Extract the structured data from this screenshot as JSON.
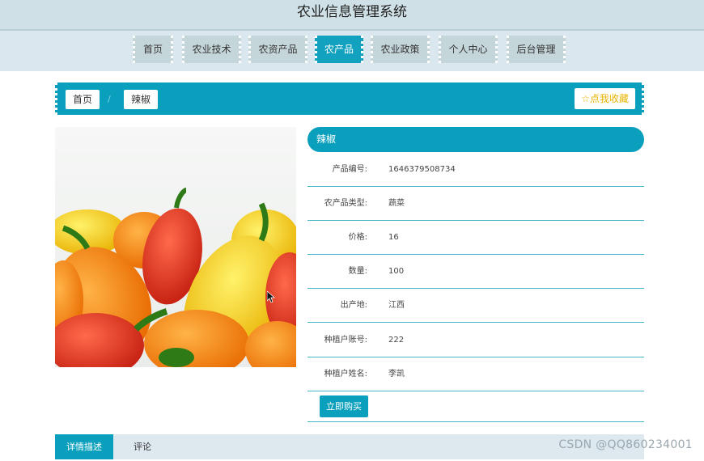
{
  "app": {
    "title": "农业信息管理系统"
  },
  "nav": {
    "items": [
      {
        "label": "首页"
      },
      {
        "label": "农业技术"
      },
      {
        "label": "农资产品"
      },
      {
        "label": "农产品"
      },
      {
        "label": "农业政策"
      },
      {
        "label": "个人中心"
      },
      {
        "label": "后台管理"
      }
    ],
    "active_index": 3
  },
  "breadcrumb": {
    "home": "首页",
    "separator": "/",
    "current": "辣椒",
    "favorite_label": "☆点我收藏"
  },
  "product": {
    "name": "辣椒",
    "image_icon": "pepper-image",
    "fields": [
      {
        "label": "产品编号:",
        "value": "1646379508734"
      },
      {
        "label": "农产品类型:",
        "value": "蔬菜"
      },
      {
        "label": "价格:",
        "value": "16"
      },
      {
        "label": "数量:",
        "value": "100"
      },
      {
        "label": "出产地:",
        "value": "江西"
      },
      {
        "label": "种植户账号:",
        "value": "222"
      },
      {
        "label": "种植户姓名:",
        "value": "李凯"
      }
    ],
    "buy_label": "立即购买"
  },
  "tabs": [
    {
      "label": "详情描述"
    },
    {
      "label": "评论"
    }
  ],
  "watermark": "CSDN @QQ860234001",
  "colors": {
    "accent": "#0aa0bd",
    "nav_bg": "#c5d6db",
    "favorite": "#e8b400"
  }
}
